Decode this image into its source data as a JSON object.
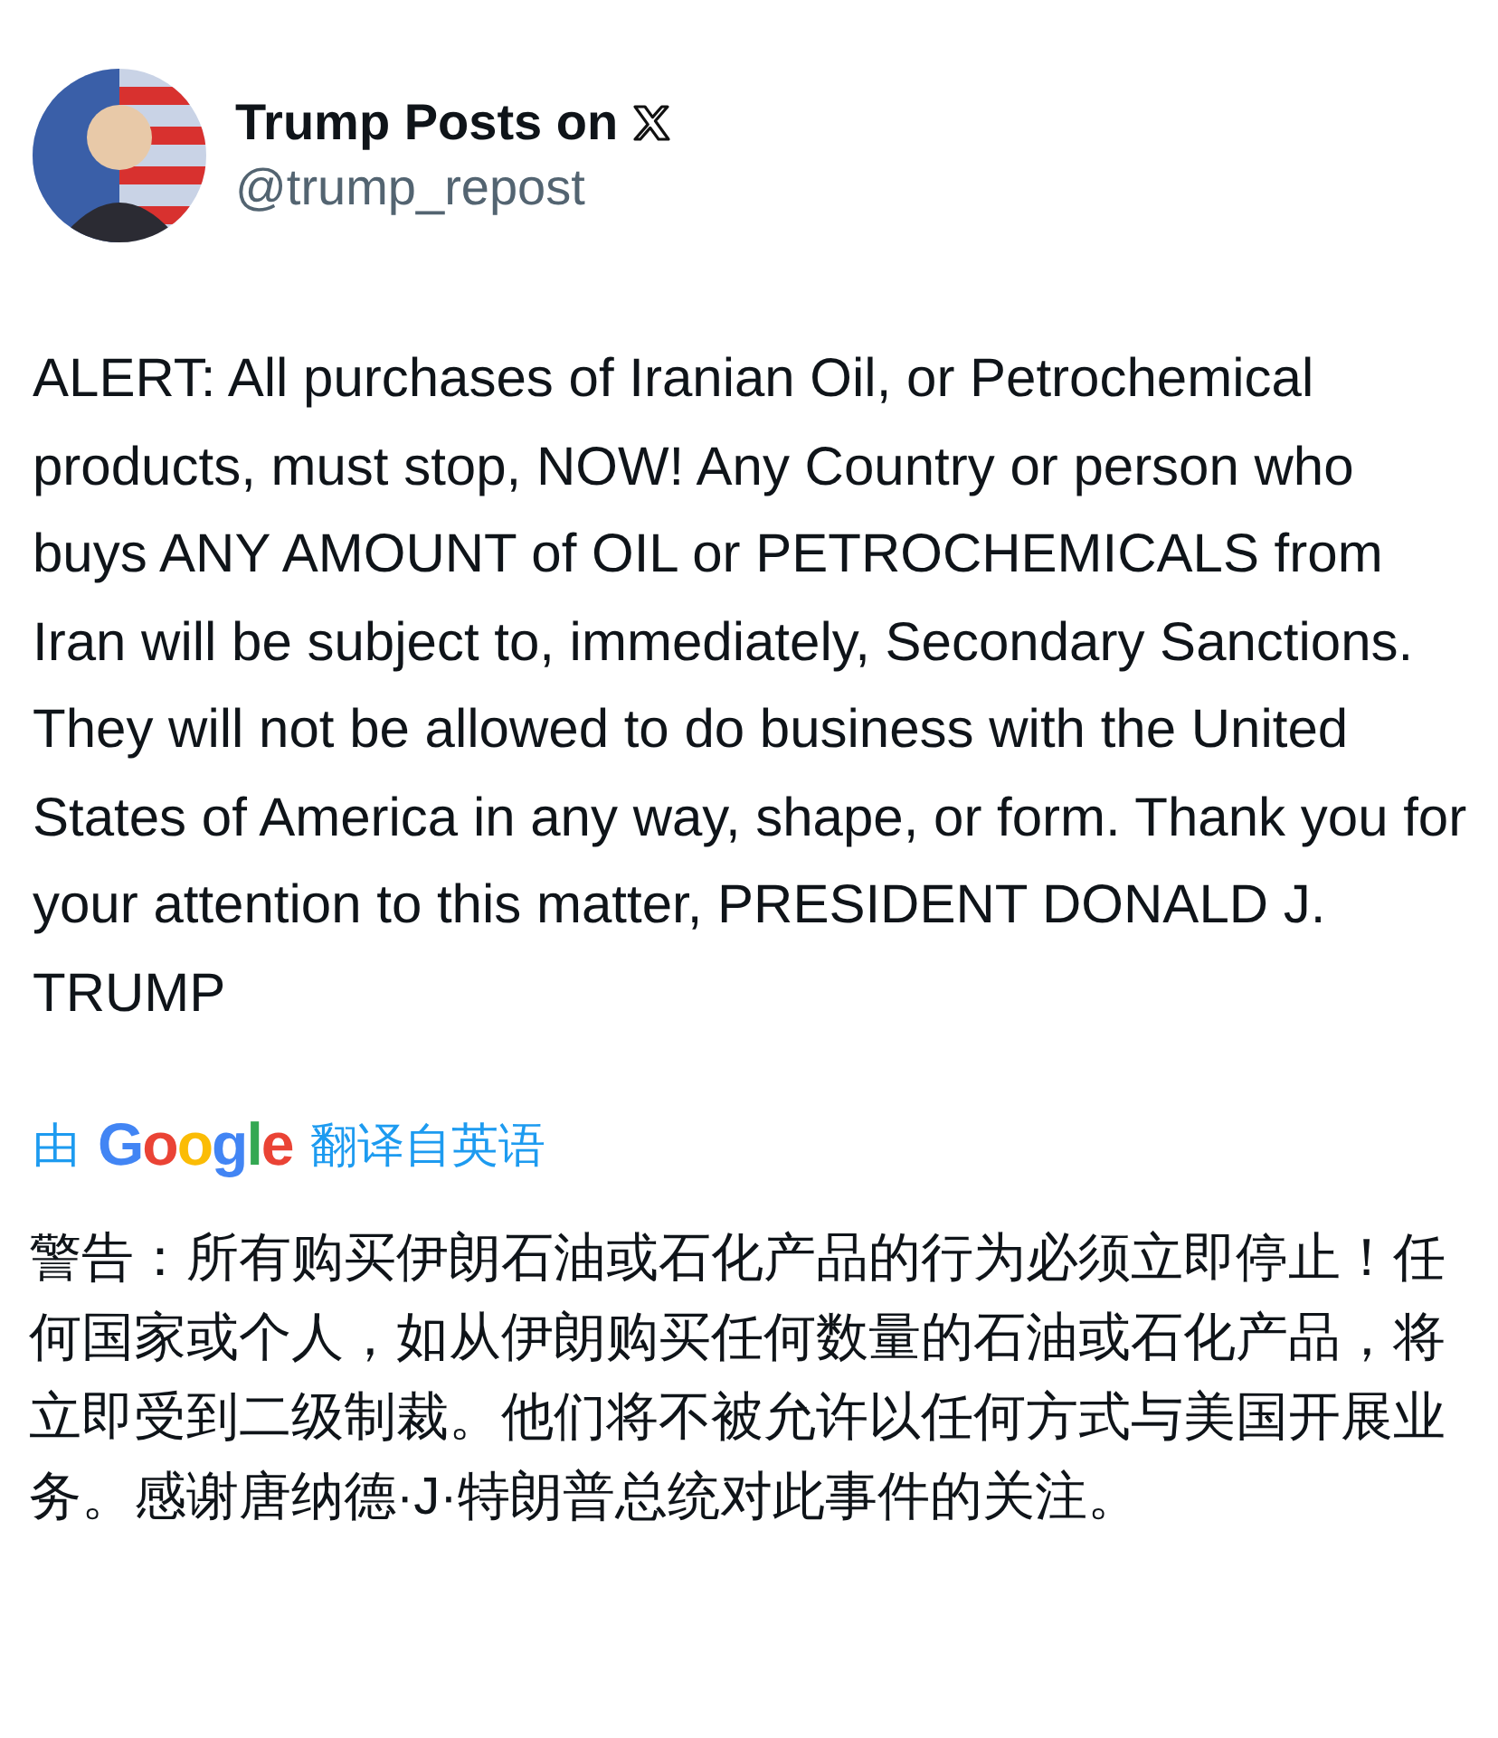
{
  "post": {
    "author": {
      "name": "Trump Posts on",
      "handle": "@trump_repost"
    },
    "text": "ALERT: All purchases of Iranian Oil, or Petrochemical products, must stop, NOW! Any Country or person who buys ANY AMOUNT of OIL or PETROCHEMICALS from Iran will be subject to, immediately, Secondary Sanctions. They will not be allowed to do business with the United States of America in any way, shape, or form. Thank you for your attention to this matter, PRESIDENT DONALD J. TRUMP",
    "translation": {
      "prefix": "由",
      "provider": "Google",
      "suffix": "翻译自英语",
      "text": "警告：所有购买伊朗石油或石化产品的行为必须立即停止！任何国家或个人，如从伊朗购买任何数量的石油或石化产品，将立即受到二级制裁。他们将不被允许以任何方式与美国开展业务。感谢唐纳德·J·特朗普总统对此事件的关注。"
    }
  }
}
